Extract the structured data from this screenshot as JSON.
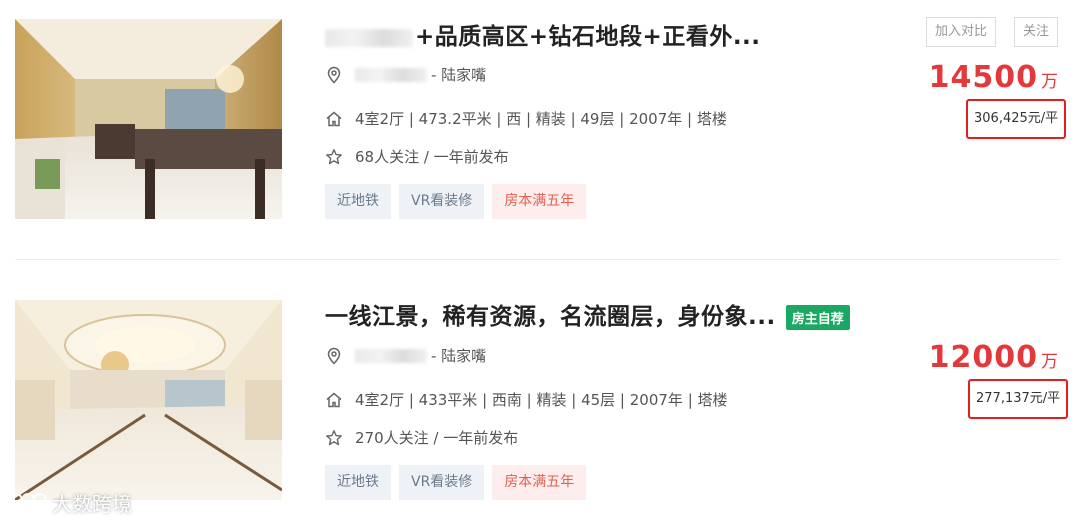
{
  "listings": [
    {
      "title_visible": "+品质高区+钻石地段+正看外...",
      "location_suffix": "- 陆家嘴",
      "specs": "4室2厅 | 473.2平米 | 西 | 精装 | 49层 | 2007年 | 塔楼",
      "stats": "68人关注 / 一年前发布",
      "tags": [
        "近地铁",
        "VR看装修",
        "房本满五年"
      ],
      "price": "14500",
      "price_unit": "万",
      "unit_price": "306,425元/平",
      "compare_label": "加入对比",
      "follow_label": "关注"
    },
    {
      "title_visible": "一线江景，稀有资源，名流圈层，身份象...",
      "badge": "房主自荐",
      "location_suffix": "- 陆家嘴",
      "specs": "4室2厅 | 433平米 | 西南 | 精装 | 45层 | 2007年 | 塔楼",
      "stats": "270人关注 / 一年前发布",
      "tags": [
        "近地铁",
        "VR看装修",
        "房本满五年"
      ],
      "price": "12000",
      "price_unit": "万",
      "unit_price": "277,137元/平"
    }
  ],
  "watermark": "大数跨境",
  "icons": {
    "location": "location-pin-icon",
    "house": "house-icon",
    "star": "star-icon"
  },
  "colors": {
    "price": "#e4393c",
    "highlight_box": "#e02020",
    "owner_badge": "#1aa863",
    "tag_warn": "#e0614f"
  }
}
